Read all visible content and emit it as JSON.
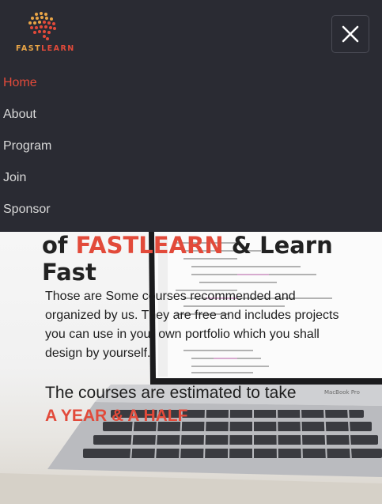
{
  "brand": {
    "name_part1": "FAST",
    "name_part2": "LEARN",
    "logo_icon": "brain-icon",
    "colors": {
      "orange": "#e9a547",
      "red": "#e24a3a"
    }
  },
  "nav": {
    "close_icon": "close-icon",
    "items": [
      {
        "label": "Home",
        "active": true
      },
      {
        "label": "About",
        "active": false
      },
      {
        "label": "Program",
        "active": false
      },
      {
        "label": "Join",
        "active": false
      },
      {
        "label": "Sponsor",
        "active": false
      }
    ]
  },
  "hero": {
    "headline_prefix": "of",
    "headline_brand": "FASTLEARN",
    "headline_suffix": "& Learn Fast",
    "description": "Those are Some courses recommended and organized by us. They are free and includes projects you can use in your own portfolio which you shall design by yourself.",
    "duration_text": "The courses are estimated to take",
    "duration_highlight": "A YEAR & A HALF",
    "laptop_badge": "MacBook Pro"
  }
}
